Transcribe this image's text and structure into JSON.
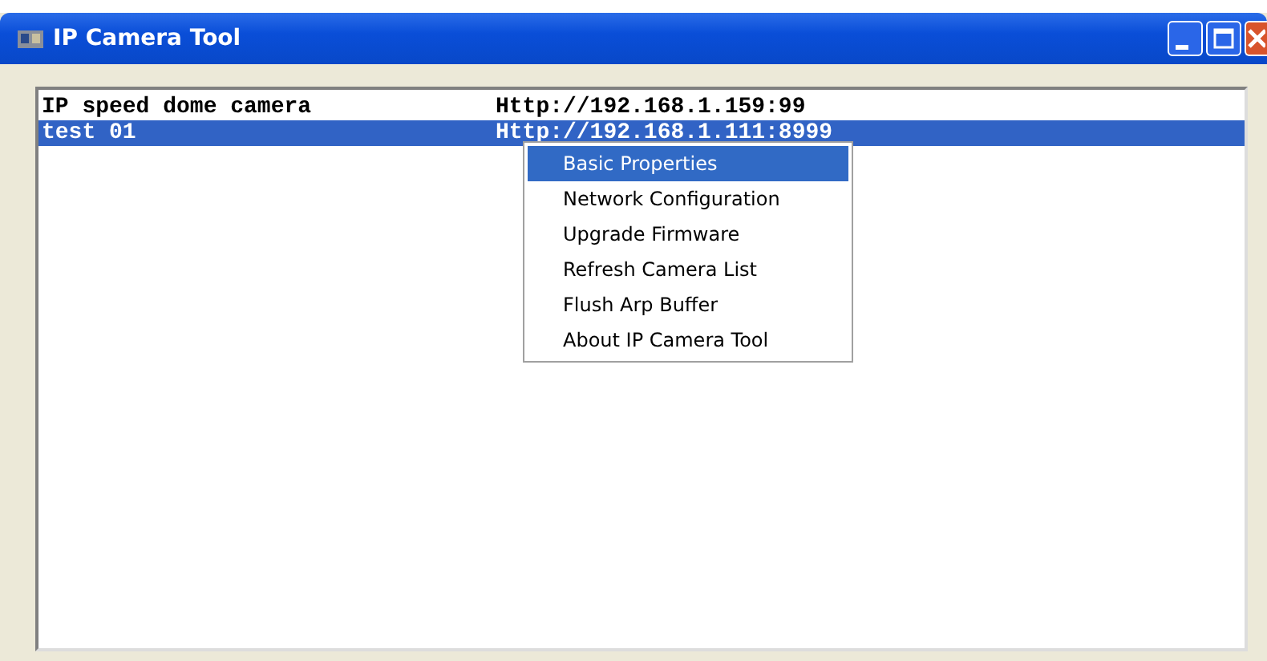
{
  "window": {
    "title": "IP Camera Tool"
  },
  "cameras": [
    {
      "name": "IP speed dome camera",
      "url": "Http://192.168.1.159:99",
      "selected": false
    },
    {
      "name": "test 01",
      "url": "Http://192.168.1.111:8999",
      "selected": true
    }
  ],
  "context_menu": [
    {
      "label": "Basic Properties",
      "selected": true
    },
    {
      "label": "Network Configuration",
      "selected": false
    },
    {
      "label": "Upgrade Firmware",
      "selected": false
    },
    {
      "label": "Refresh Camera List",
      "selected": false
    },
    {
      "label": "Flush Arp Buffer",
      "selected": false
    },
    {
      "label": "About IP Camera Tool",
      "selected": false
    }
  ]
}
